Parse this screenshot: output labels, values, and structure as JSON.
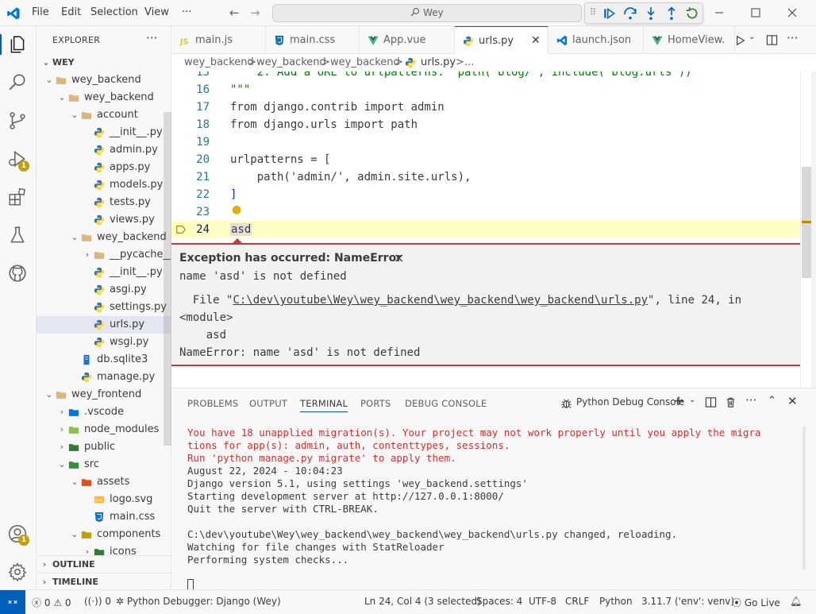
{
  "menu": [
    "File",
    "Edit",
    "Selection",
    "View",
    "···"
  ],
  "search": {
    "text": "Wey"
  },
  "explorer": {
    "title": "EXPLORER",
    "more": "···",
    "root": "WEY",
    "items": [
      {
        "label": "wey_backend",
        "indent": 1,
        "kind": "folder",
        "open": true
      },
      {
        "label": "wey_backend",
        "indent": 2,
        "kind": "folder",
        "open": true
      },
      {
        "label": "account",
        "indent": 3,
        "kind": "folder",
        "open": true
      },
      {
        "label": "__init__.py",
        "indent": 4,
        "kind": "py"
      },
      {
        "label": "admin.py",
        "indent": 4,
        "kind": "py"
      },
      {
        "label": "apps.py",
        "indent": 4,
        "kind": "py"
      },
      {
        "label": "models.py",
        "indent": 4,
        "kind": "py"
      },
      {
        "label": "tests.py",
        "indent": 4,
        "kind": "py"
      },
      {
        "label": "views.py",
        "indent": 4,
        "kind": "py"
      },
      {
        "label": "wey_backend",
        "indent": 3,
        "kind": "folder",
        "open": true
      },
      {
        "label": "__pycache__",
        "indent": 4,
        "kind": "folder",
        "open": false
      },
      {
        "label": "__init__.py",
        "indent": 4,
        "kind": "py"
      },
      {
        "label": "asgi.py",
        "indent": 4,
        "kind": "py"
      },
      {
        "label": "settings.py",
        "indent": 4,
        "kind": "py"
      },
      {
        "label": "urls.py",
        "indent": 4,
        "kind": "py",
        "selected": true
      },
      {
        "label": "wsgi.py",
        "indent": 4,
        "kind": "py"
      },
      {
        "label": "db.sqlite3",
        "indent": 3,
        "kind": "db"
      },
      {
        "label": "manage.py",
        "indent": 3,
        "kind": "py"
      },
      {
        "label": "wey_frontend",
        "indent": 1,
        "kind": "folder",
        "open": true
      },
      {
        "label": ".vscode",
        "indent": 2,
        "kind": "vscode",
        "open": false
      },
      {
        "label": "node_modules",
        "indent": 2,
        "kind": "node",
        "open": false
      },
      {
        "label": "public",
        "indent": 2,
        "kind": "public",
        "open": false
      },
      {
        "label": "src",
        "indent": 2,
        "kind": "src",
        "open": true
      },
      {
        "label": "assets",
        "indent": 3,
        "kind": "assets",
        "open": true
      },
      {
        "label": "logo.svg",
        "indent": 4,
        "kind": "svg"
      },
      {
        "label": "main.css",
        "indent": 4,
        "kind": "css"
      },
      {
        "label": "components",
        "indent": 3,
        "kind": "components",
        "open": true
      },
      {
        "label": "icons",
        "indent": 4,
        "kind": "icons",
        "open": false
      }
    ],
    "outline": "OUTLINE",
    "timeline": "TIMELINE"
  },
  "tabs": [
    {
      "label": "main.js",
      "kind": "js"
    },
    {
      "label": "main.css",
      "kind": "css"
    },
    {
      "label": "App.vue",
      "kind": "vue"
    },
    {
      "label": "urls.py",
      "kind": "py",
      "active": true
    },
    {
      "label": "launch.json",
      "kind": "vscode"
    },
    {
      "label": "HomeView.",
      "kind": "vue"
    }
  ],
  "breadcrumb": [
    "wey_backend",
    ">",
    "wey_backend",
    ">",
    "wey_backend",
    ">",
    "urls.py",
    ">",
    "..."
  ],
  "code": {
    "lines": [
      {
        "n": "15",
        "text": "    2. Add a URL to urlpatterns:  path('blog/', include('blog.urls'))"
      },
      {
        "n": "16",
        "text": "\"\"\""
      },
      {
        "n": "17",
        "text": "from django.contrib import admin"
      },
      {
        "n": "18",
        "text": "from django.urls import path"
      },
      {
        "n": "19",
        "text": ""
      },
      {
        "n": "20",
        "text": "urlpatterns = ["
      },
      {
        "n": "21",
        "text": "    path('admin/', admin.site.urls),"
      },
      {
        "n": "22",
        "text": "]"
      },
      {
        "n": "23",
        "text": ""
      },
      {
        "n": "24",
        "text": "asd"
      }
    ]
  },
  "exception": {
    "title": "Exception has occurred: NameError",
    "close": "×",
    "message": "name 'asd' is not defined",
    "trace_prefix": "  File \"",
    "trace_path": "C:\\dev\\youtube\\Wey\\wey_backend\\wey_backend\\wey_backend\\urls.py",
    "trace_suffix": "\", line 24, in",
    "trace_module": "<module>",
    "trace_code": "    asd",
    "final": "NameError: name 'asd' is not defined"
  },
  "panel": {
    "tabs": [
      "PROBLEMS",
      "OUTPUT",
      "TERMINAL",
      "PORTS",
      "DEBUG CONSOLE"
    ],
    "active_tab": "TERMINAL",
    "terminal_name": "Python Debug Console",
    "lines": [
      {
        "text": "You have 18 unapplied migration(s). Your project may not work properly until you apply the migra",
        "red": true
      },
      {
        "text": "tions for app(s): admin, auth, contenttypes, sessions.",
        "red": true
      },
      {
        "text": "Run 'python manage.py migrate' to apply them.",
        "red": true
      },
      {
        "text": "August 22, 2024 - 10:04:23",
        "red": false
      },
      {
        "text": "Django version 5.1, using settings 'wey_backend.settings'",
        "red": false
      },
      {
        "text": "Starting development server at http://127.0.0.1:8000/",
        "red": false
      },
      {
        "text": "Quit the server with CTRL-BREAK.",
        "red": false
      },
      {
        "text": "",
        "red": false
      },
      {
        "text": "C:\\dev\\youtube\\Wey\\wey_backend\\wey_backend\\wey_backend\\urls.py changed, reloading.",
        "red": false
      },
      {
        "text": "Watching for file changes with StatReloader",
        "red": false
      },
      {
        "text": "Performing system checks...",
        "red": false
      }
    ]
  },
  "status": {
    "errors": "0",
    "warnings": "0",
    "ports": "0",
    "debugger": "Python Debugger: Django (Wey)",
    "position": "Ln 24, Col 4 (3 selected)",
    "spaces": "Spaces: 4",
    "encoding": "UTF-8",
    "eol": "CRLF",
    "language": "Python",
    "interpreter": "3.11.7 ('env': venv)",
    "golive": "Go Live"
  },
  "badges": {
    "debug": "1",
    "account": "1"
  },
  "colors": {
    "accent": "#005fb8",
    "error": "#c53a3a",
    "python": "#3776ab",
    "vue": "#41b883",
    "folder": "#dcb67a"
  }
}
